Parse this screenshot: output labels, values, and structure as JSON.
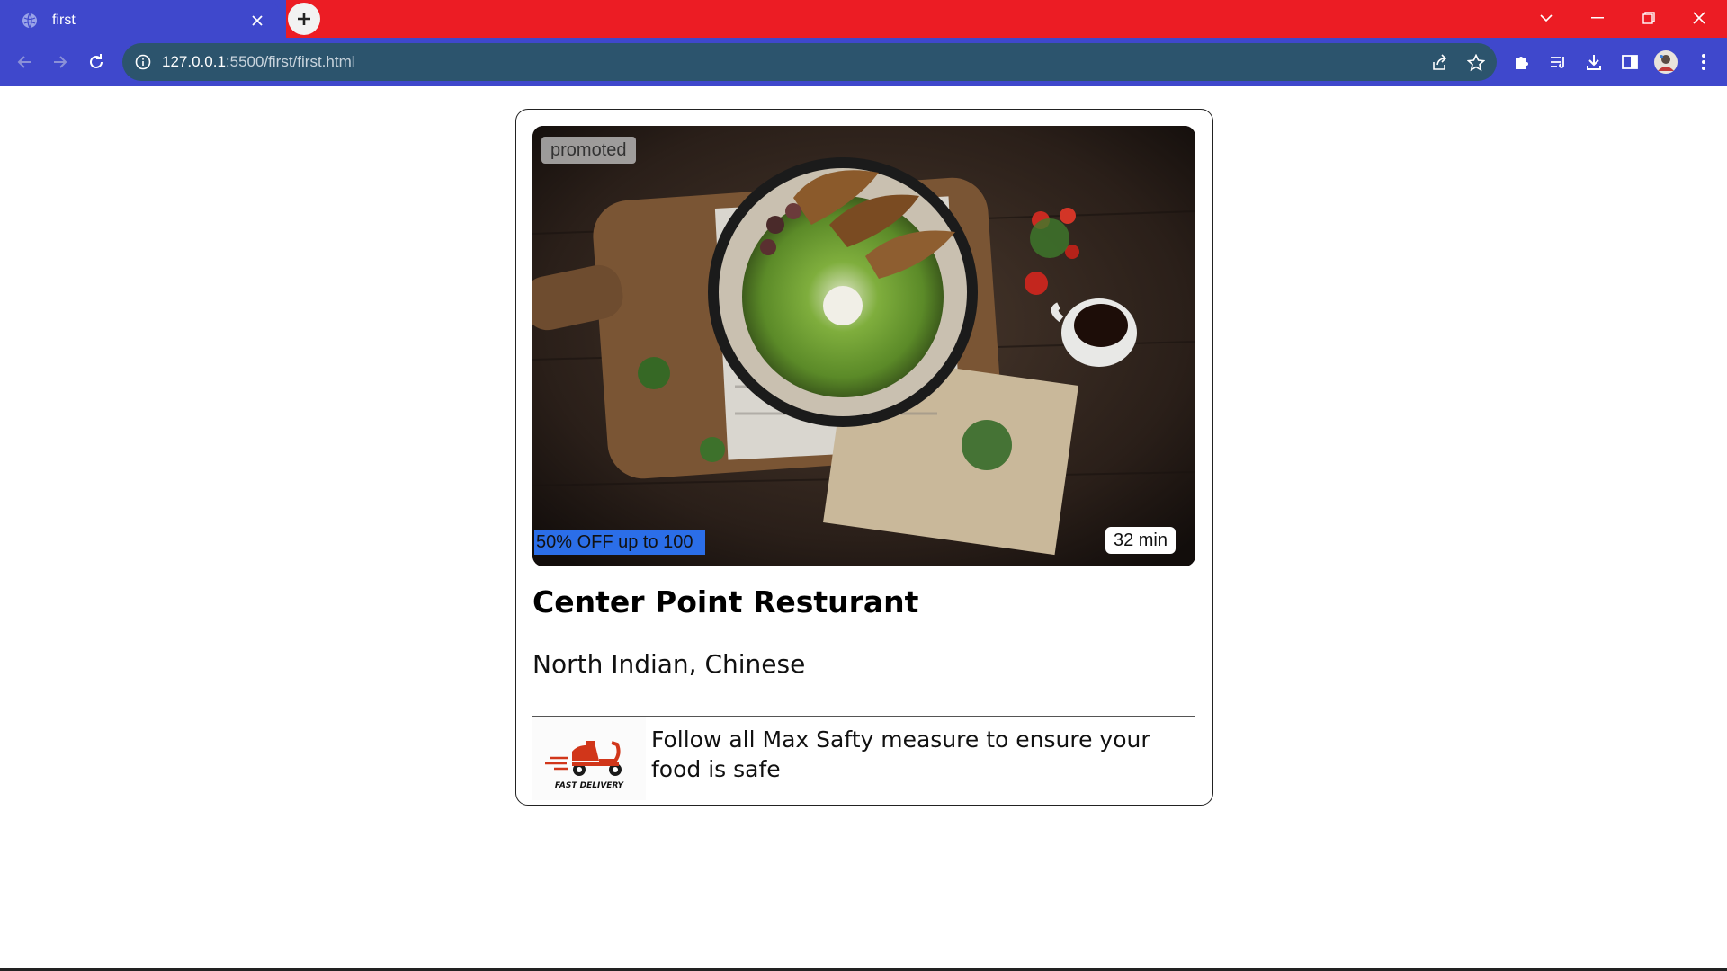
{
  "browser": {
    "tab_title": "first",
    "url_host": "127.0.0.1",
    "url_path": ":5500/first/first.html",
    "colors": {
      "tabbar": "#ec1c24",
      "toolbar": "#3f48cc",
      "omnibox": "#2c546d"
    }
  },
  "card": {
    "badge_promoted": "promoted",
    "offer": "50% OFF up to 100",
    "delivery_time": "32 min",
    "restaurant_name": "Center Point Resturant",
    "cuisine": "North Indian, Chinese",
    "safety_note": "Follow all Max Safty measure to ensure your food is safe",
    "delivery_logo_text": "FAST DELIVERY",
    "colors": {
      "offer_bg": "#2b6ee8",
      "border": "#222222"
    }
  }
}
